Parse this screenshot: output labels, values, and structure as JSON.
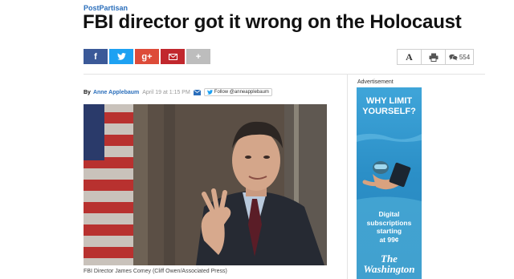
{
  "article": {
    "kicker": "PostPartisan",
    "headline": "FBI director got it wrong on the Holocaust",
    "byline": {
      "by": "By",
      "author": "Anne Applebaum",
      "date": "April 19 at 1:15 PM",
      "follow": "Follow @anneapplebaum"
    },
    "caption": "FBI Director James Comey (Cliff Owen/Associated Press)"
  },
  "share": {
    "facebook_label": "f",
    "googleplus_label": "g+",
    "more_label": "+"
  },
  "tools": {
    "font_label": "A",
    "comment_count": "554"
  },
  "sidebar": {
    "ad_label": "Advertisement",
    "ad": {
      "headline_line1": "WHY LIMIT",
      "headline_line2": "YOURSELF?",
      "offer_line1": "Digital",
      "offer_line2": "subscriptions",
      "offer_line3": "starting",
      "offer_line4": "at 99¢",
      "logo_line1": "The",
      "logo_line2": "Washington"
    }
  },
  "colors": {
    "link_blue": "#2a6ebb",
    "facebook": "#3b5998",
    "twitter": "#1da1f2",
    "googleplus": "#dd4b39",
    "email": "#c1272d",
    "ad_blue": "#2b8fc7"
  }
}
